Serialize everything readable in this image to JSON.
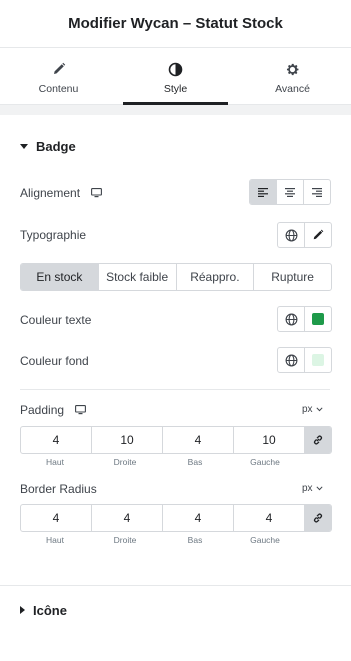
{
  "header": {
    "title": "Modifier Wycan – Statut Stock"
  },
  "tabs": [
    {
      "label": "Contenu",
      "icon": "pencil-icon"
    },
    {
      "label": "Style",
      "icon": "contrast-icon"
    },
    {
      "label": "Avancé",
      "icon": "gear-icon"
    }
  ],
  "active_tab": "Style",
  "badge_section": {
    "title": "Badge",
    "alignment": {
      "label": "Alignement",
      "options": [
        "left",
        "center",
        "right"
      ],
      "selected": "left"
    },
    "typography": {
      "label": "Typographie"
    },
    "states": {
      "options": [
        "En stock",
        "Stock faible",
        "Réappro.",
        "Rupture"
      ],
      "selected": "En stock"
    },
    "text_color": {
      "label": "Couleur texte",
      "value": "#1e9a4a"
    },
    "bg_color": {
      "label": "Couleur fond",
      "value": "#dcf5e4"
    },
    "padding": {
      "label": "Padding",
      "unit": "px",
      "values": [
        "4",
        "10",
        "4",
        "10"
      ],
      "sides": [
        "Haut",
        "Droite",
        "Bas",
        "Gauche"
      ]
    },
    "border_radius": {
      "label": "Border Radius",
      "unit": "px",
      "values": [
        "4",
        "4",
        "4",
        "4"
      ],
      "sides": [
        "Haut",
        "Droite",
        "Bas",
        "Gauche"
      ]
    }
  },
  "icon_section": {
    "title": "Icône"
  },
  "colors": {
    "accent": "#1f2124",
    "border": "#d5d8dc",
    "active_bg": "#d5d8dc"
  }
}
